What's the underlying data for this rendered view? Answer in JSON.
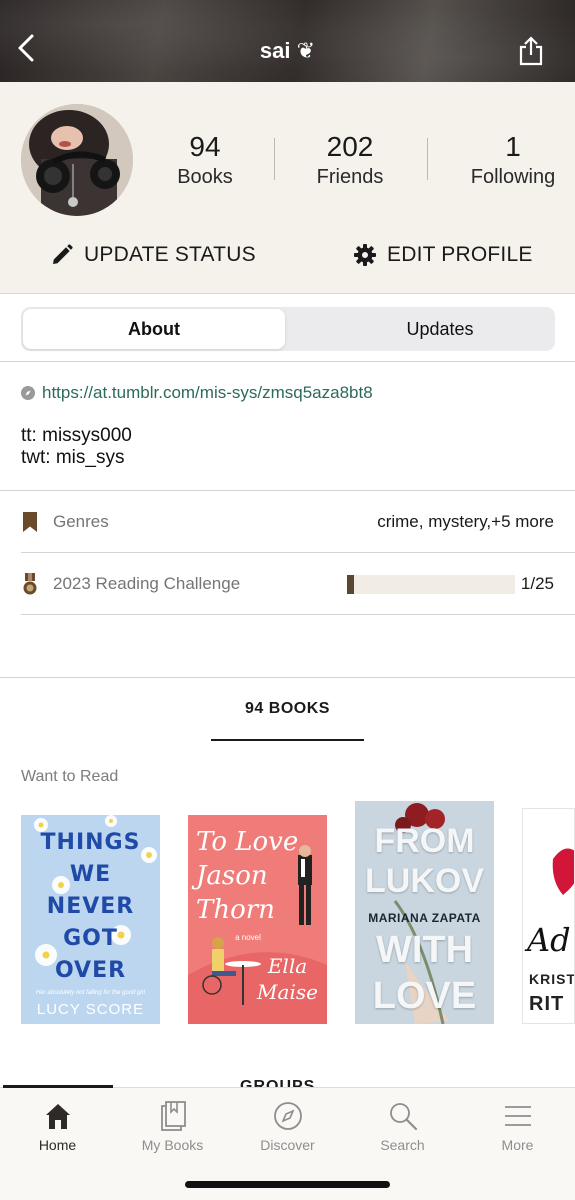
{
  "header": {
    "title": "sai ❦",
    "back_icon": "chevron-left-icon",
    "share_icon": "share-icon"
  },
  "profile": {
    "stats": [
      {
        "value": "94",
        "label": "Books"
      },
      {
        "value": "202",
        "label": "Friends"
      },
      {
        "value": "1",
        "label": "Following"
      }
    ],
    "update_status_label": "UPDATE STATUS",
    "edit_profile_label": "EDIT PROFILE"
  },
  "segment": {
    "about_label": "About",
    "updates_label": "Updates",
    "selected": "About"
  },
  "about": {
    "link": "https://at.tumblr.com/mis-sys/zmsq5aza8bt8",
    "bio_line1": "tt: missys000",
    "bio_line2": "twt: mis_sys",
    "genres_label": "Genres",
    "genres_value": "crime, mystery,+5 more",
    "challenge_label": "2023 Reading Challenge",
    "challenge_progress_text": "1/25",
    "challenge_progress_fraction": 0.04
  },
  "books": {
    "tab_label": "94 BOOKS",
    "shelf_label": "Want to Read",
    "covers": [
      {
        "title_lines": [
          "THINGS",
          "WE",
          "NEVER",
          "GOT",
          "OVER"
        ],
        "tagline": "Her absolutely not falling for the good girl",
        "author": "LUCY SCORE"
      },
      {
        "title_lines": [
          "To Love",
          "Jason",
          "Thorn"
        ],
        "subtitle": "a novel",
        "author_lines": [
          "Ella",
          "Maise"
        ]
      },
      {
        "title_lines": [
          "FROM",
          "LUKOV"
        ],
        "author": "MARIANA ZAPATA",
        "title_lines_2": [
          "WITH",
          "LOVE"
        ]
      },
      {
        "visible_text": [
          "Ad",
          "KRIST",
          "RIT"
        ]
      }
    ],
    "next_section_peek": "GROUPS"
  },
  "tabbar": {
    "items": [
      {
        "label": "Home",
        "icon": "home-icon"
      },
      {
        "label": "My Books",
        "icon": "books-icon"
      },
      {
        "label": "Discover",
        "icon": "compass-icon"
      },
      {
        "label": "Search",
        "icon": "search-icon"
      },
      {
        "label": "More",
        "icon": "menu-icon"
      }
    ],
    "active": "Home"
  },
  "colors": {
    "profile_bg": "#f5f2ec",
    "link": "#2b6a5c",
    "progress_fill": "#5b4634",
    "progress_track": "#f2ede4",
    "shelf_icon": "#6b4a2a"
  }
}
